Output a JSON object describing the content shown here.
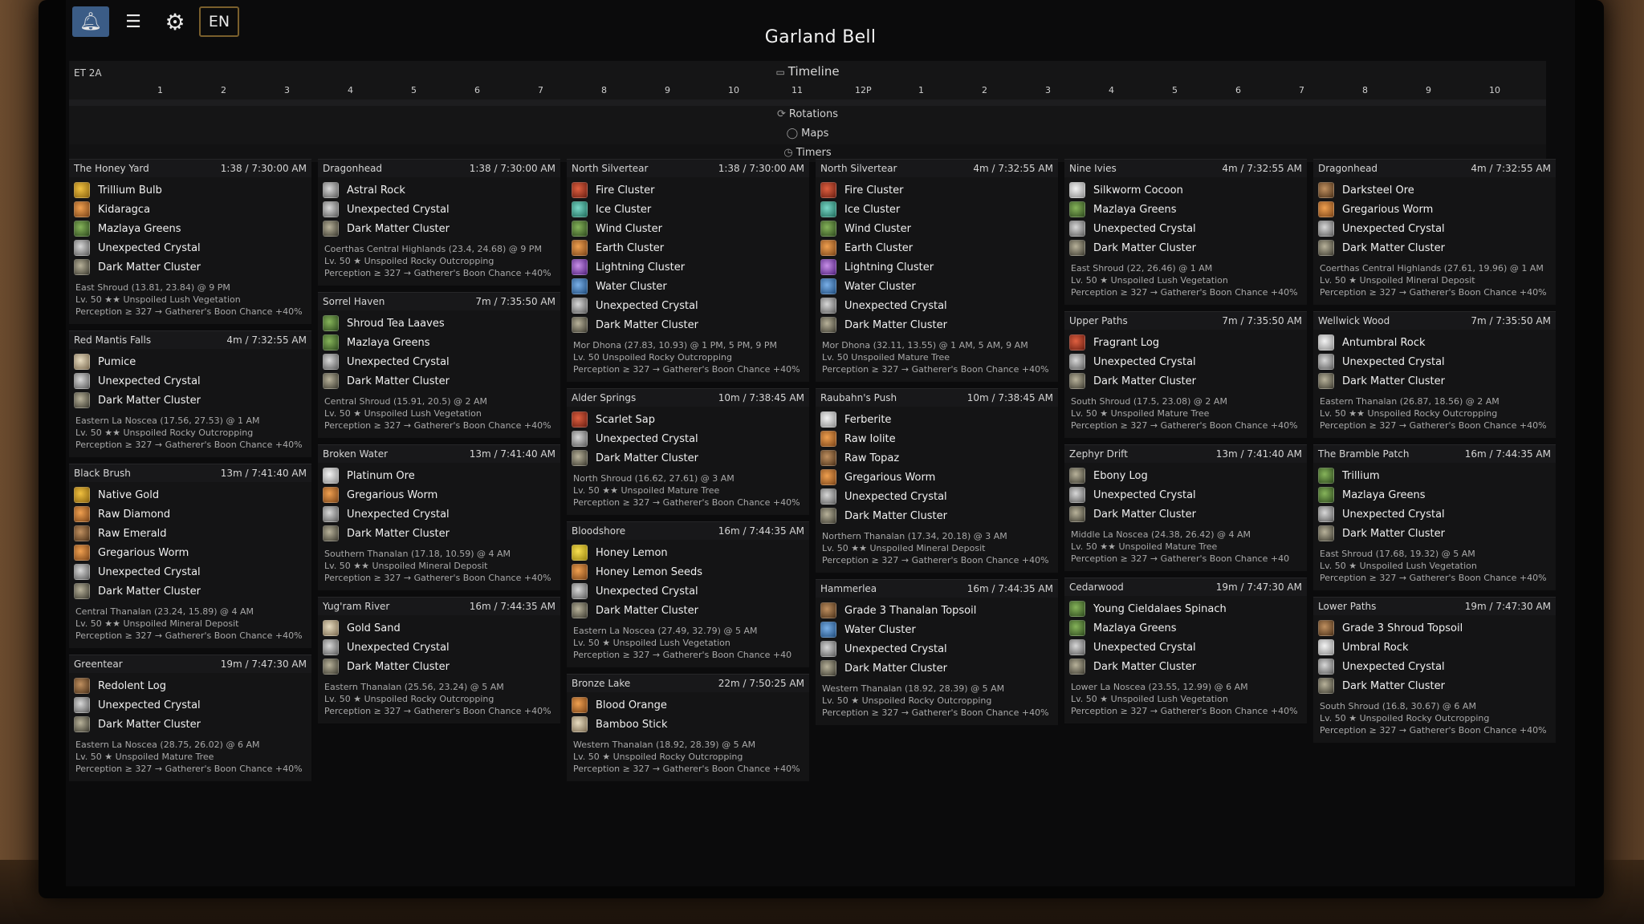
{
  "app": {
    "title": "Garland Bell"
  },
  "toolbar": {
    "bell_icon": "bell-icon",
    "list_icon": "list-icon",
    "gear_icon": "gear-icon",
    "language": "EN"
  },
  "timeline": {
    "label": "Timeline",
    "et": "ET 2A",
    "hours": [
      "1",
      "2",
      "3",
      "4",
      "5",
      "6",
      "7",
      "8",
      "9",
      "10",
      "11",
      "12P",
      "1",
      "2",
      "3",
      "4",
      "5",
      "6",
      "7",
      "8",
      "9",
      "10"
    ]
  },
  "sections": {
    "rotations": "Rotations",
    "maps": "Maps",
    "timers": "Timers"
  },
  "columns": [
    [
      {
        "name": "The Honey Yard",
        "time": "1:38 / 7:30:00 AM",
        "items": [
          {
            "label": "Trillium Bulb",
            "icon": "gold"
          },
          {
            "label": "Kidaragca",
            "icon": "orange"
          },
          {
            "label": "Mazlaya Greens",
            "icon": "green"
          },
          {
            "label": "Unexpected Crystal",
            "icon": "crystal"
          },
          {
            "label": "Dark Matter Cluster",
            "icon": "dark"
          }
        ],
        "location": "East Shroud (13.81, 23.84) @ 9 PM",
        "node": "Lv. 50 ★★ Unspoiled Lush Vegetation",
        "bonus": "Perception ≥ 327 → Gatherer's Boon Chance +40%"
      },
      {
        "name": "Red Mantis Falls",
        "time": "4m / 7:32:55 AM",
        "items": [
          {
            "label": "Pumice",
            "icon": "pale"
          },
          {
            "label": "Unexpected Crystal",
            "icon": "crystal"
          },
          {
            "label": "Dark Matter Cluster",
            "icon": "dark"
          }
        ],
        "location": "Eastern La Noscea (17.56, 27.53) @ 1 AM",
        "node": "Lv. 50 ★★ Unspoiled Rocky Outcropping",
        "bonus": "Perception ≥ 327 → Gatherer's Boon Chance +40%"
      },
      {
        "name": "Black Brush",
        "time": "13m / 7:41:40 AM",
        "items": [
          {
            "label": "Native Gold",
            "icon": "gold"
          },
          {
            "label": "Raw Diamond",
            "icon": "orange"
          },
          {
            "label": "Raw Emerald",
            "icon": "brown"
          },
          {
            "label": "Gregarious Worm",
            "icon": "orange"
          },
          {
            "label": "Unexpected Crystal",
            "icon": "crystal"
          },
          {
            "label": "Dark Matter Cluster",
            "icon": "dark"
          }
        ],
        "location": "Central Thanalan (23.24, 15.89) @ 4 AM",
        "node": "Lv. 50 ★★ Unspoiled Mineral Deposit",
        "bonus": "Perception ≥ 327 → Gatherer's Boon Chance +40%"
      },
      {
        "name": "Greentear",
        "time": "19m / 7:47:30 AM",
        "items": [
          {
            "label": "Redolent Log",
            "icon": "brown"
          },
          {
            "label": "Unexpected Crystal",
            "icon": "crystal"
          },
          {
            "label": "Dark Matter Cluster",
            "icon": "dark"
          }
        ],
        "location": "Eastern La Noscea (28.75, 26.02) @ 6 AM",
        "node": "Lv. 50 ★ Unspoiled Mature Tree",
        "bonus": "Perception ≥ 327 → Gatherer's Boon Chance +40%"
      }
    ],
    [
      {
        "name": "Dragonhead",
        "time": "1:38 / 7:30:00 AM",
        "items": [
          {
            "label": "Astral Rock",
            "icon": "crystal"
          },
          {
            "label": "Unexpected Crystal",
            "icon": "crystal"
          },
          {
            "label": "Dark Matter Cluster",
            "icon": "dark"
          }
        ],
        "location": "Coerthas Central Highlands (23.4, 24.68) @ 9 PM",
        "node": "Lv. 50 ★ Unspoiled Rocky Outcropping",
        "bonus": "Perception ≥ 327 → Gatherer's Boon Chance +40%"
      },
      {
        "name": "Sorrel Haven",
        "time": "7m / 7:35:50 AM",
        "items": [
          {
            "label": "Shroud Tea Laaves",
            "icon": "green"
          },
          {
            "label": "Mazlaya Greens",
            "icon": "green"
          },
          {
            "label": "Unexpected Crystal",
            "icon": "crystal"
          },
          {
            "label": "Dark Matter Cluster",
            "icon": "dark"
          }
        ],
        "location": "Central Shroud (15.91, 20.5) @ 2 AM",
        "node": "Lv. 50 ★ Unspoiled Lush Vegetation",
        "bonus": "Perception ≥ 327 → Gatherer's Boon Chance +40%"
      },
      {
        "name": "Broken Water",
        "time": "13m / 7:41:40 AM",
        "items": [
          {
            "label": "Platinum Ore",
            "icon": "white"
          },
          {
            "label": "Gregarious Worm",
            "icon": "orange"
          },
          {
            "label": "Unexpected Crystal",
            "icon": "crystal"
          },
          {
            "label": "Dark Matter Cluster",
            "icon": "dark"
          }
        ],
        "location": "Southern Thanalan (17.18, 10.59) @ 4 AM",
        "node": "Lv. 50 ★★ Unspoiled Mineral Deposit",
        "bonus": "Perception ≥ 327 → Gatherer's Boon Chance +40%"
      },
      {
        "name": "Yug'ram River",
        "time": "16m / 7:44:35 AM",
        "items": [
          {
            "label": "Gold Sand",
            "icon": "pale"
          },
          {
            "label": "Unexpected Crystal",
            "icon": "crystal"
          },
          {
            "label": "Dark Matter Cluster",
            "icon": "dark"
          }
        ],
        "location": "Eastern Thanalan (25.56, 23.24) @ 5 AM",
        "node": "Lv. 50 ★ Unspoiled Rocky Outcropping",
        "bonus": "Perception ≥ 327 → Gatherer's Boon Chance +40%"
      }
    ],
    [
      {
        "name": "North Silvertear",
        "time": "1:38 / 7:30:00 AM",
        "items": [
          {
            "label": "Fire Cluster",
            "icon": "red"
          },
          {
            "label": "Ice Cluster",
            "icon": "teal"
          },
          {
            "label": "Wind Cluster",
            "icon": "green"
          },
          {
            "label": "Earth Cluster",
            "icon": "orange"
          },
          {
            "label": "Lightning Cluster",
            "icon": "purple"
          },
          {
            "label": "Water Cluster",
            "icon": "blue"
          },
          {
            "label": "Unexpected Crystal",
            "icon": "crystal"
          },
          {
            "label": "Dark Matter Cluster",
            "icon": "dark"
          }
        ],
        "location": "Mor Dhona (27.83, 10.93) @ 1 PM, 5 PM, 9 PM",
        "node": "Lv. 50 Unspoiled Rocky Outcropping",
        "bonus": "Perception ≥ 327 → Gatherer's Boon Chance +40%"
      },
      {
        "name": "Alder Springs",
        "time": "10m / 7:38:45 AM",
        "items": [
          {
            "label": "Scarlet Sap",
            "icon": "red"
          },
          {
            "label": "Unexpected Crystal",
            "icon": "crystal"
          },
          {
            "label": "Dark Matter Cluster",
            "icon": "dark"
          }
        ],
        "location": "North Shroud (16.62, 27.61) @ 3 AM",
        "node": "Lv. 50 ★★ Unspoiled Mature Tree",
        "bonus": "Perception ≥ 327 → Gatherer's Boon Chance +40%"
      },
      {
        "name": "Bloodshore",
        "time": "16m / 7:44:35 AM",
        "items": [
          {
            "label": "Honey Lemon",
            "icon": "yellow"
          },
          {
            "label": "Honey Lemon Seeds",
            "icon": "orange"
          },
          {
            "label": "Unexpected Crystal",
            "icon": "crystal"
          },
          {
            "label": "Dark Matter Cluster",
            "icon": "dark"
          }
        ],
        "location": "Eastern La Noscea (27.49, 32.79) @ 5 AM",
        "node": "Lv. 50 ★ Unspoiled Lush Vegetation",
        "bonus": "Perception ≥ 327 → Gatherer's Boon Chance +40"
      },
      {
        "name": "Bronze Lake",
        "time": "22m / 7:50:25 AM",
        "items": [
          {
            "label": "Blood Orange",
            "icon": "orange"
          },
          {
            "label": "Bamboo Stick",
            "icon": "pale"
          }
        ],
        "location": "Western Thanalan (18.92, 28.39) @ 5 AM",
        "node": "Lv. 50 ★ Unspoiled Rocky Outcropping",
        "bonus": "Perception ≥ 327 → Gatherer's Boon Chance +40%"
      }
    ],
    [
      {
        "name": "North Silvertear",
        "time": "4m / 7:32:55 AM",
        "items": [
          {
            "label": "Fire Cluster",
            "icon": "red"
          },
          {
            "label": "Ice Cluster",
            "icon": "teal"
          },
          {
            "label": "Wind Cluster",
            "icon": "green"
          },
          {
            "label": "Earth Cluster",
            "icon": "orange"
          },
          {
            "label": "Lightning Cluster",
            "icon": "purple"
          },
          {
            "label": "Water Cluster",
            "icon": "blue"
          },
          {
            "label": "Unexpected Crystal",
            "icon": "crystal"
          },
          {
            "label": "Dark Matter Cluster",
            "icon": "dark"
          }
        ],
        "location": "Mor Dhona (32.11, 13.55) @ 1 AM, 5 AM, 9 AM",
        "node": "Lv. 50 Unspoiled Mature Tree",
        "bonus": "Perception ≥ 327 → Gatherer's Boon Chance +40%"
      },
      {
        "name": "Raubahn's Push",
        "time": "10m / 7:38:45 AM",
        "items": [
          {
            "label": "Ferberite",
            "icon": "white"
          },
          {
            "label": "Raw Iolite",
            "icon": "orange"
          },
          {
            "label": "Raw Topaz",
            "icon": "brown"
          },
          {
            "label": "Gregarious Worm",
            "icon": "orange"
          },
          {
            "label": "Unexpected Crystal",
            "icon": "crystal"
          },
          {
            "label": "Dark Matter Cluster",
            "icon": "dark"
          }
        ],
        "location": "Northern Thanalan (17.34, 20.18) @ 3 AM",
        "node": "Lv. 50 ★★ Unspoiled Mineral Deposit",
        "bonus": "Perception ≥ 327 → Gatherer's Boon Chance +40%"
      },
      {
        "name": "Hammerlea",
        "time": "16m / 7:44:35 AM",
        "items": [
          {
            "label": "Grade 3 Thanalan Topsoil",
            "icon": "brown"
          },
          {
            "label": "Water Cluster",
            "icon": "blue"
          },
          {
            "label": "Unexpected Crystal",
            "icon": "crystal"
          },
          {
            "label": "Dark Matter Cluster",
            "icon": "dark"
          }
        ],
        "location": "Western Thanalan (18.92, 28.39) @ 5 AM",
        "node": "Lv. 50 ★ Unspoiled Rocky Outcropping",
        "bonus": "Perception ≥ 327 → Gatherer's Boon Chance +40%"
      }
    ],
    [
      {
        "name": "Nine Ivies",
        "time": "4m / 7:32:55 AM",
        "items": [
          {
            "label": "Silkworm Cocoon",
            "icon": "white"
          },
          {
            "label": "Mazlaya Greens",
            "icon": "green"
          },
          {
            "label": "Unexpected Crystal",
            "icon": "crystal"
          },
          {
            "label": "Dark Matter Cluster",
            "icon": "dark"
          }
        ],
        "location": "East Shroud (22, 26.46) @ 1 AM",
        "node": "Lv. 50 ★ Unspoiled Lush Vegetation",
        "bonus": "Perception ≥ 327 → Gatherer's Boon Chance +40%"
      },
      {
        "name": "Upper Paths",
        "time": "7m / 7:35:50 AM",
        "items": [
          {
            "label": "Fragrant Log",
            "icon": "red"
          },
          {
            "label": "Unexpected Crystal",
            "icon": "crystal"
          },
          {
            "label": "Dark Matter Cluster",
            "icon": "dark"
          }
        ],
        "location": "South Shroud (17.5, 23.08) @ 2 AM",
        "node": "Lv. 50 ★ Unspoiled Mature Tree",
        "bonus": "Perception ≥ 327 → Gatherer's Boon Chance +40%"
      },
      {
        "name": "Zephyr Drift",
        "time": "13m / 7:41:40 AM",
        "items": [
          {
            "label": "Ebony Log",
            "icon": "dark"
          },
          {
            "label": "Unexpected Crystal",
            "icon": "crystal"
          },
          {
            "label": "Dark Matter Cluster",
            "icon": "dark"
          }
        ],
        "location": "Middle La Noscea (24.38, 26.42) @ 4 AM",
        "node": "Lv. 50 ★★ Unspoiled Mature Tree",
        "bonus": "Perception ≥ 327 → Gatherer's Boon Chance +40"
      },
      {
        "name": "Cedarwood",
        "time": "19m / 7:47:30 AM",
        "items": [
          {
            "label": "Young Cieldalaes Spinach",
            "icon": "green"
          },
          {
            "label": "Mazlaya Greens",
            "icon": "green"
          },
          {
            "label": "Unexpected Crystal",
            "icon": "crystal"
          },
          {
            "label": "Dark Matter Cluster",
            "icon": "dark"
          }
        ],
        "location": "Lower La Noscea (23.55, 12.99) @ 6 AM",
        "node": "Lv. 50 ★ Unspoiled Lush Vegetation",
        "bonus": "Perception ≥ 327 → Gatherer's Boon Chance +40%"
      }
    ],
    [
      {
        "name": "Dragonhead",
        "time": "4m / 7:32:55 AM",
        "items": [
          {
            "label": "Darksteel Ore",
            "icon": "brown"
          },
          {
            "label": "Gregarious Worm",
            "icon": "orange"
          },
          {
            "label": "Unexpected Crystal",
            "icon": "crystal"
          },
          {
            "label": "Dark Matter Cluster",
            "icon": "dark"
          }
        ],
        "location": "Coerthas Central Highlands (27.61, 19.96) @ 1 AM",
        "node": "Lv. 50 ★ Unspoiled Mineral Deposit",
        "bonus": "Perception ≥ 327 → Gatherer's Boon Chance +40%"
      },
      {
        "name": "Wellwick Wood",
        "time": "7m / 7:35:50 AM",
        "items": [
          {
            "label": "Antumbral Rock",
            "icon": "white"
          },
          {
            "label": "Unexpected Crystal",
            "icon": "crystal"
          },
          {
            "label": "Dark Matter Cluster",
            "icon": "dark"
          }
        ],
        "location": "Eastern Thanalan (26.87, 18.56) @ 2 AM",
        "node": "Lv. 50 ★★ Unspoiled Rocky Outcropping",
        "bonus": "Perception ≥ 327 → Gatherer's Boon Chance +40%"
      },
      {
        "name": "The Bramble Patch",
        "time": "16m / 7:44:35 AM",
        "items": [
          {
            "label": "Trillium",
            "icon": "green"
          },
          {
            "label": "Mazlaya Greens",
            "icon": "green"
          },
          {
            "label": "Unexpected Crystal",
            "icon": "crystal"
          },
          {
            "label": "Dark Matter Cluster",
            "icon": "dark"
          }
        ],
        "location": "East Shroud (17.68, 19.32) @ 5 AM",
        "node": "Lv. 50 ★ Unspoiled Lush Vegetation",
        "bonus": "Perception ≥ 327 → Gatherer's Boon Chance +40%"
      },
      {
        "name": "Lower Paths",
        "time": "19m / 7:47:30 AM",
        "items": [
          {
            "label": "Grade 3 Shroud Topsoil",
            "icon": "brown"
          },
          {
            "label": "Umbral Rock",
            "icon": "white"
          },
          {
            "label": "Unexpected Crystal",
            "icon": "crystal"
          },
          {
            "label": "Dark Matter Cluster",
            "icon": "dark"
          }
        ],
        "location": "South Shroud (16.8, 30.67) @ 6 AM",
        "node": "Lv. 50 ★ Unspoiled Rocky Outcropping",
        "bonus": "Perception ≥ 327 → Gatherer's Boon Chance +40%"
      }
    ]
  ]
}
